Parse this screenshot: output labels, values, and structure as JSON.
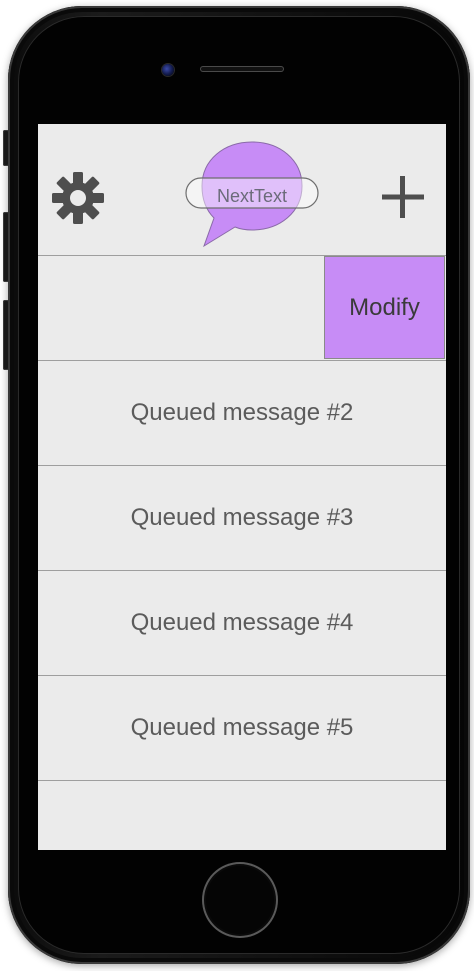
{
  "app": {
    "logo_text": "NextText",
    "brand_color": "#c78cf6",
    "background_color": "#ebebeb"
  },
  "header": {
    "left_icon": "gear-icon",
    "right_icon": "plus-icon"
  },
  "first_row": {
    "action_label": "Modify"
  },
  "queue": [
    {
      "label": "Queued message #2"
    },
    {
      "label": "Queued message #3"
    },
    {
      "label": "Queued message #4"
    },
    {
      "label": "Queued message #5"
    }
  ]
}
